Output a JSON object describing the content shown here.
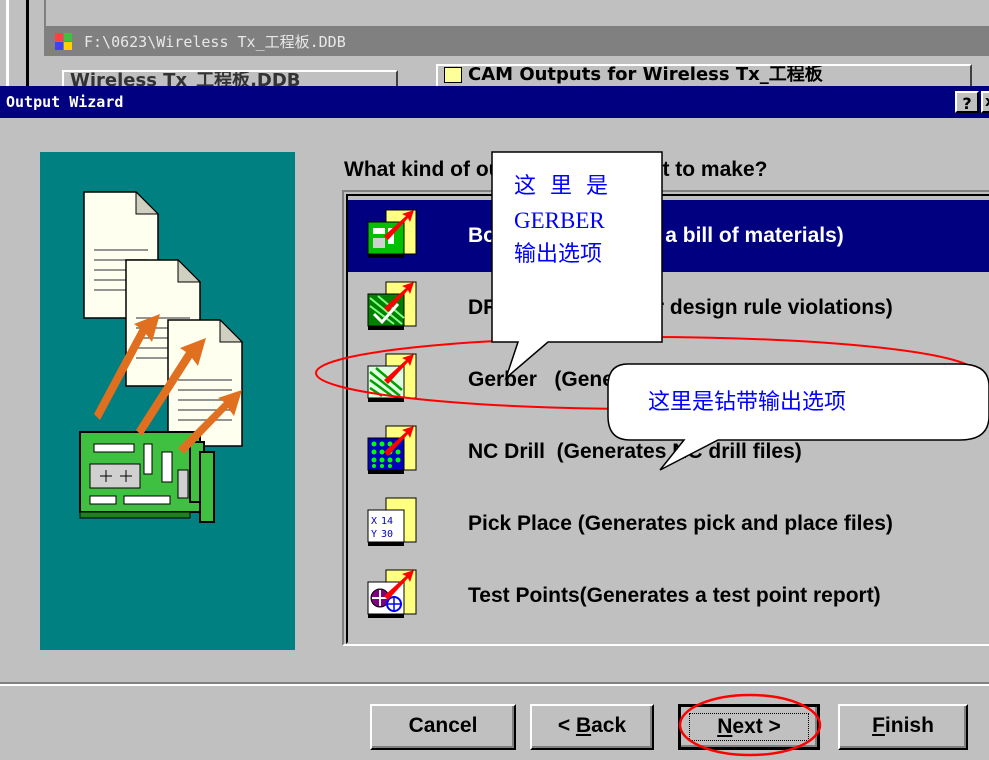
{
  "background_window": {
    "title": "F:\\0623\\Wireless Tx_工程板.DDB",
    "tab_left_label": "Wireless Tx_工程板.DDB",
    "tab_active_label": "CAM Outputs for Wireless Tx_工程板"
  },
  "dialog": {
    "title": "Output Wizard",
    "help_label": "?",
    "close_label": "x",
    "question": "What kind of output do you want to make?"
  },
  "list": {
    "items": [
      {
        "label": "Bom      (Generates a bill of materials)",
        "icon": "bom-icon",
        "selected": true
      },
      {
        "label": "DRC      (Checks for design rule violations)",
        "icon": "drc-icon",
        "selected": false
      },
      {
        "label": "Gerber   (Generates Gerber files)",
        "icon": "gerber-icon",
        "selected": false
      },
      {
        "label": "NC Drill  (Generates NC drill files)",
        "icon": "nc-drill-icon",
        "selected": false
      },
      {
        "label": "Pick Place (Generates pick and place files)",
        "icon": "pick-place-icon",
        "selected": false
      },
      {
        "label": "Test Points(Generates a test point report)",
        "icon": "test-points-icon",
        "selected": false
      }
    ]
  },
  "buttons": {
    "cancel": "Cancel",
    "back_prefix": "< ",
    "back_mnemonic": "B",
    "back_rest": "ack",
    "next_mnemonic": "N",
    "next_rest": "ext >",
    "finish_mnemonic": "F",
    "finish_rest": "inish"
  },
  "annotations": {
    "callout_top_line1": "这里是",
    "callout_top_line2": "GERBER",
    "callout_top_line3": "输出选项",
    "callout_right": "这里是钻带输出选项"
  },
  "colors": {
    "titlebar_active": "#000080",
    "titlebar_inactive": "#808080",
    "panel_teal": "#008080",
    "annotation_red": "#ff0000",
    "annotation_blue": "#0000ff"
  }
}
